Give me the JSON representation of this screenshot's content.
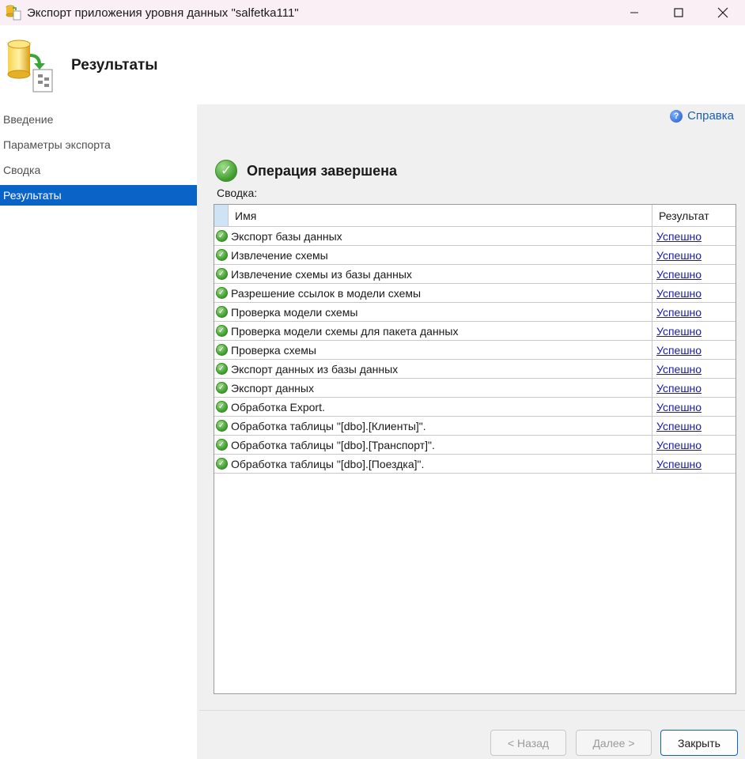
{
  "window": {
    "title": "Экспорт приложения уровня данных \"salfetka111\"",
    "minimize_glyph": "—",
    "maximize_glyph": "☐",
    "close_glyph": "✕"
  },
  "header": {
    "title": "Результаты"
  },
  "sidebar": {
    "items": [
      {
        "label": "Введение"
      },
      {
        "label": "Параметры экспорта"
      },
      {
        "label": "Сводка"
      },
      {
        "label": "Результаты"
      }
    ],
    "active_index": 3
  },
  "main": {
    "help_label": "Справка",
    "status_title": "Операция завершена",
    "summary_label": "Сводка:",
    "columns": {
      "name": "Имя",
      "result": "Результат"
    },
    "rows": [
      {
        "name": "Экспорт базы данных",
        "result": "Успешно"
      },
      {
        "name": "Извлечение схемы",
        "result": "Успешно"
      },
      {
        "name": "Извлечение схемы из базы данных",
        "result": "Успешно"
      },
      {
        "name": "Разрешение ссылок в модели схемы",
        "result": "Успешно"
      },
      {
        "name": "Проверка модели схемы",
        "result": "Успешно"
      },
      {
        "name": "Проверка модели схемы для пакета данных",
        "result": "Успешно"
      },
      {
        "name": "Проверка схемы",
        "result": "Успешно"
      },
      {
        "name": "Экспорт данных из базы данных",
        "result": "Успешно"
      },
      {
        "name": "Экспорт данных",
        "result": "Успешно"
      },
      {
        "name": "Обработка Export.",
        "result": "Успешно"
      },
      {
        "name": "Обработка таблицы \"[dbo].[Клиенты]\".",
        "result": "Успешно"
      },
      {
        "name": "Обработка таблицы \"[dbo].[Транспорт]\".",
        "result": "Успешно"
      },
      {
        "name": "Обработка таблицы \"[dbo].[Поездка]\".",
        "result": "Успешно"
      }
    ]
  },
  "footer": {
    "back_label": "< Назад",
    "next_label": "Далее >",
    "close_label": "Закрыть"
  },
  "colors": {
    "accent": "#0a64c8",
    "success": "#3f9a2e",
    "link": "#1a1aa8",
    "titlebar": "#fbeff6"
  },
  "icons": {
    "app": "database-export-icon",
    "header": "database-export-icon",
    "help": "help-icon",
    "status": "check-circle-icon"
  }
}
